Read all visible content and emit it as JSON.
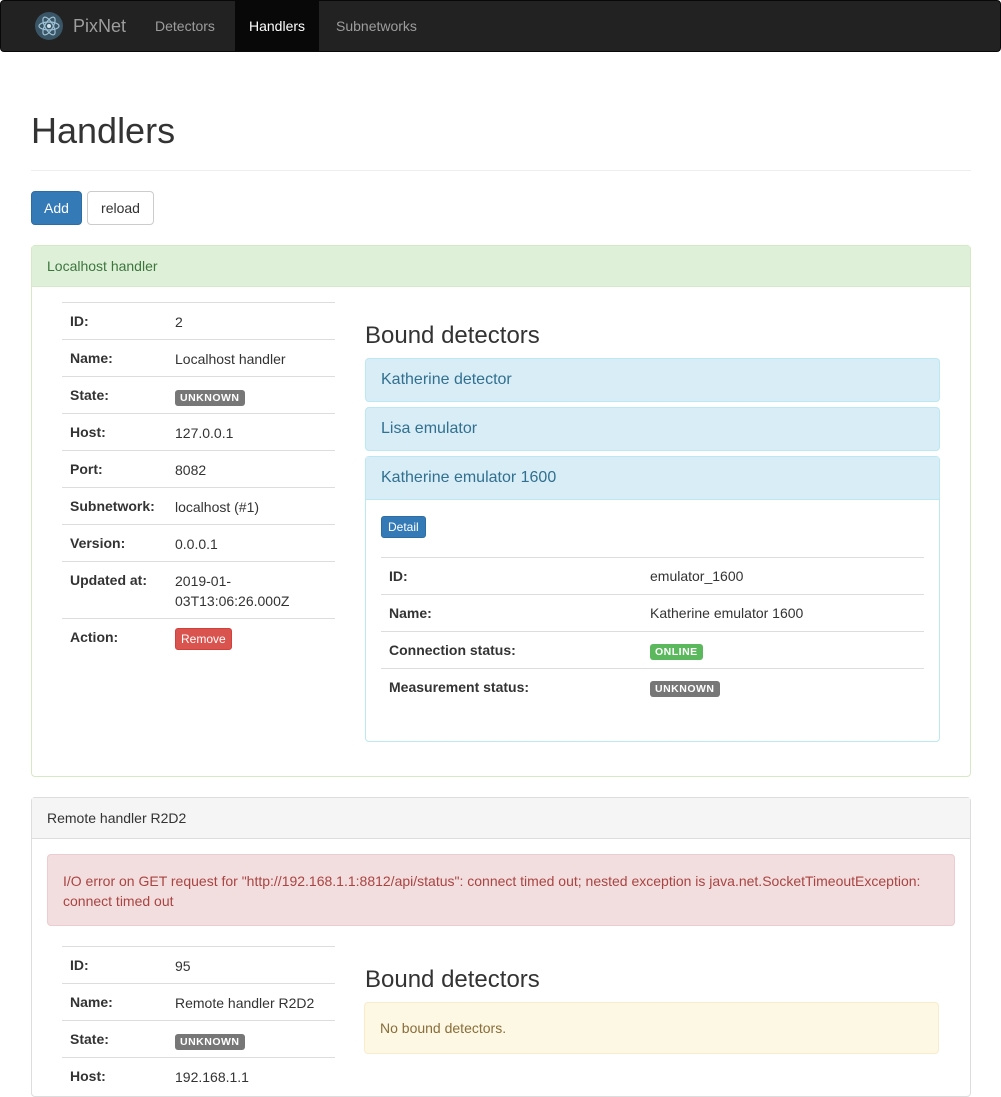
{
  "navbar": {
    "brand": "PixNet",
    "items": [
      {
        "label": "Detectors",
        "active": false
      },
      {
        "label": "Handlers",
        "active": true
      },
      {
        "label": "Subnetworks",
        "active": false
      }
    ]
  },
  "page": {
    "title": "Handlers",
    "add_label": "Add",
    "reload_label": "reload"
  },
  "handlers": [
    {
      "title": "Localhost handler",
      "rows": [
        {
          "label": "ID:",
          "value": "2"
        },
        {
          "label": "Name:",
          "value": "Localhost handler"
        },
        {
          "label": "State:",
          "badge": "UNKNOWN"
        },
        {
          "label": "Host:",
          "value": "127.0.0.1"
        },
        {
          "label": "Port:",
          "value": "8082"
        },
        {
          "label": "Subnetwork:",
          "value": "localhost (#1)"
        },
        {
          "label": "Version:",
          "value": "0.0.0.1"
        },
        {
          "label": "Updated at:",
          "value": "2019-01-03T13:06:26.000Z"
        },
        {
          "label": "Action:",
          "button": "Remove"
        }
      ],
      "bound_title": "Bound detectors",
      "detectors": [
        {
          "name": "Katherine detector"
        },
        {
          "name": "Lisa emulator"
        },
        {
          "name": "Katherine emulator 1600",
          "detail_label": "Detail",
          "rows": [
            {
              "label": "ID:",
              "value": "emulator_1600"
            },
            {
              "label": "Name:",
              "value": "Katherine emulator 1600"
            },
            {
              "label": "Connection status:",
              "badge": "ONLINE"
            },
            {
              "label": "Measurement status:",
              "badge": "UNKNOWN"
            }
          ]
        }
      ]
    },
    {
      "title": "Remote handler R2D2",
      "error": "I/O error on GET request for \"http://192.168.1.1:8812/api/status\": connect timed out; nested exception is java.net.SocketTimeoutException: connect timed out",
      "rows": [
        {
          "label": "ID:",
          "value": "95"
        },
        {
          "label": "Name:",
          "value": "Remote handler R2D2"
        },
        {
          "label": "State:",
          "badge": "UNKNOWN"
        },
        {
          "label": "Host:",
          "value": "192.168.1.1"
        }
      ],
      "bound_title": "Bound detectors",
      "no_detectors": "No bound detectors."
    }
  ],
  "colors": {
    "navbar_bg": "#222222",
    "primary": "#337ab7",
    "success_panel": "#dff0d8",
    "info_panel": "#d9edf7",
    "danger": "#d9534f",
    "badge_default": "#777777",
    "badge_success": "#5cb85c"
  }
}
